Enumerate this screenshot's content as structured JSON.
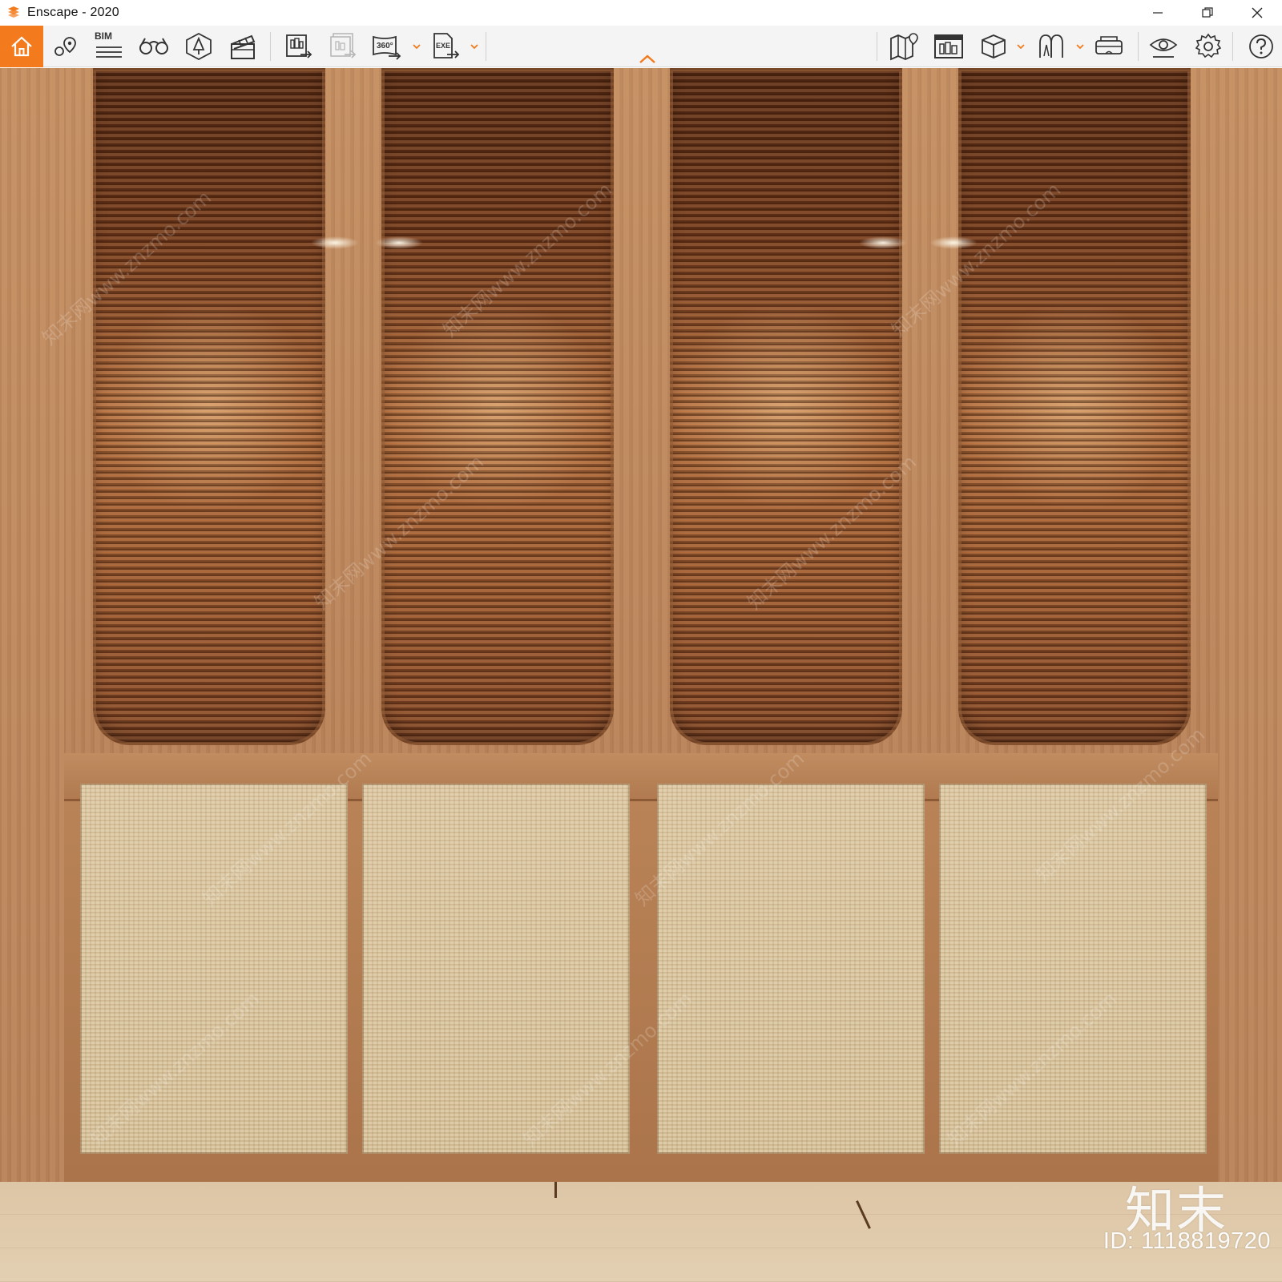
{
  "window": {
    "title": "Enscape - 2020",
    "logo_icon": "enscape-logo-icon",
    "controls": [
      "minimize-icon",
      "restore-icon",
      "close-icon"
    ]
  },
  "toolbar": {
    "accent_color": "#f37b1d",
    "left_buttons": [
      {
        "name": "home",
        "icon": "home-icon"
      },
      {
        "name": "view-management",
        "icon": "location-pin-icon"
      },
      {
        "name": "bim",
        "icon": "bim-list-icon",
        "label": "BIM"
      },
      {
        "name": "binoculars",
        "icon": "binoculars-icon"
      },
      {
        "name": "asset-library",
        "icon": "tree-asset-icon"
      },
      {
        "name": "video-editor",
        "icon": "clapperboard-icon"
      },
      {
        "name": "batch-render",
        "icon": "batch-render-icon"
      },
      {
        "name": "export-disabled",
        "icon": "export-disabled-icon"
      },
      {
        "name": "panorama-360",
        "icon": "panorama-360-icon",
        "label": "360°"
      },
      {
        "name": "exe-export",
        "icon": "exe-export-icon",
        "label": "EXE"
      }
    ],
    "right_buttons": [
      {
        "name": "map",
        "icon": "map-icon"
      },
      {
        "name": "render-settings",
        "icon": "render-settings-icon"
      },
      {
        "name": "view-mode",
        "icon": "cube-icon"
      },
      {
        "name": "walk-fly",
        "icon": "walk-icon"
      },
      {
        "name": "vr-headset",
        "icon": "vr-headset-icon"
      },
      {
        "name": "visual-settings",
        "icon": "eye-icon"
      },
      {
        "name": "general-settings",
        "icon": "gear-icon"
      },
      {
        "name": "help",
        "icon": "help-icon"
      }
    ],
    "collapse_icon": "chevron-up-icon"
  },
  "viewport": {
    "watermark_logo": "知末",
    "watermark_id": "ID: 1118819720",
    "watermark_repeat": "知末网www.znzmo.com"
  }
}
